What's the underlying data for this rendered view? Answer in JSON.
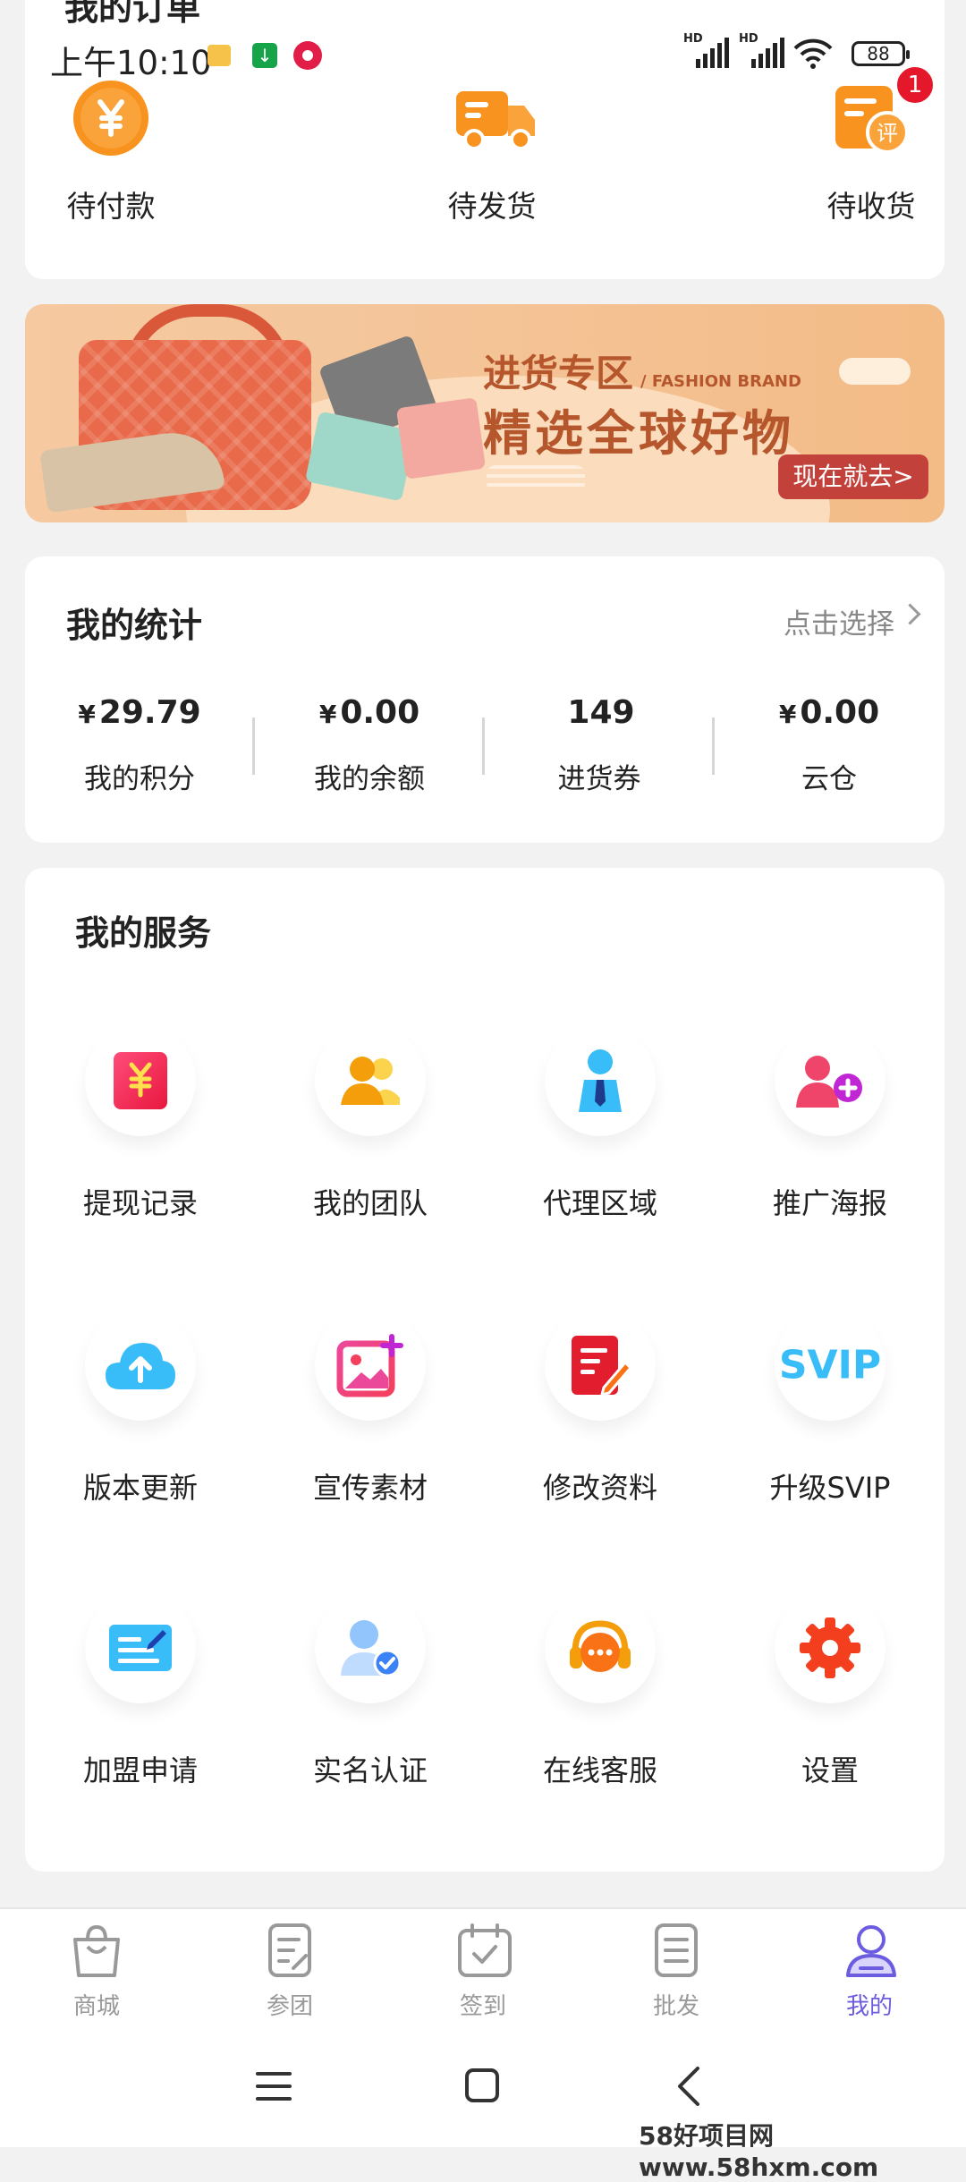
{
  "order": {
    "title": "我的订单",
    "items": [
      {
        "label": "待付款",
        "icon": "yen-coin-icon"
      },
      {
        "label": "待发货",
        "icon": "delivery-truck-icon"
      },
      {
        "label": "待收货",
        "icon": "review-box-icon",
        "badge": "1"
      }
    ]
  },
  "status_bar": {
    "time": "上午10:10",
    "battery": "88"
  },
  "banner": {
    "title": "进货专区",
    "subtitle_en": "/ FASHION BRAND",
    "headline": "精选全球好物",
    "button": "现在就去>"
  },
  "stats": {
    "title": "我的统计",
    "select": "点击选择",
    "items": [
      {
        "currency": "¥",
        "value": "29.79",
        "label": "我的积分"
      },
      {
        "currency": "¥",
        "value": "0.00",
        "label": "我的余额"
      },
      {
        "currency": "",
        "value": "149",
        "label": "进货券"
      },
      {
        "currency": "¥",
        "value": "0.00",
        "label": "云仓"
      }
    ]
  },
  "services": {
    "title": "我的服务",
    "items": [
      {
        "label": "提现记录",
        "icon": "withdraw-record-icon"
      },
      {
        "label": "我的团队",
        "icon": "team-icon"
      },
      {
        "label": "代理区域",
        "icon": "agent-region-icon"
      },
      {
        "label": "推广海报",
        "icon": "promo-poster-icon"
      },
      {
        "label": "版本更新",
        "icon": "cloud-upload-icon"
      },
      {
        "label": "宣传素材",
        "icon": "image-material-icon"
      },
      {
        "label": "修改资料",
        "icon": "edit-profile-icon"
      },
      {
        "label": "升级SVIP",
        "icon": "svip-icon",
        "text": "SVIP"
      },
      {
        "label": "加盟申请",
        "icon": "join-application-icon"
      },
      {
        "label": "实名认证",
        "icon": "verified-user-icon"
      },
      {
        "label": "在线客服",
        "icon": "customer-service-icon"
      },
      {
        "label": "设置",
        "icon": "gear-icon"
      }
    ]
  },
  "tabs": [
    {
      "label": "商城",
      "icon": "shopping-bag-icon"
    },
    {
      "label": "参团",
      "icon": "group-document-icon"
    },
    {
      "label": "签到",
      "icon": "calendar-check-icon"
    },
    {
      "label": "批发",
      "icon": "list-document-icon"
    },
    {
      "label": "我的",
      "icon": "user-profile-icon",
      "active": true
    }
  ],
  "watermark": "58好项目网www.58hxm.com",
  "colors": {
    "accent": "#6b5ce0",
    "badge": "#e5172b",
    "banner_button": "#c2413a",
    "orange": "#f7931e"
  }
}
